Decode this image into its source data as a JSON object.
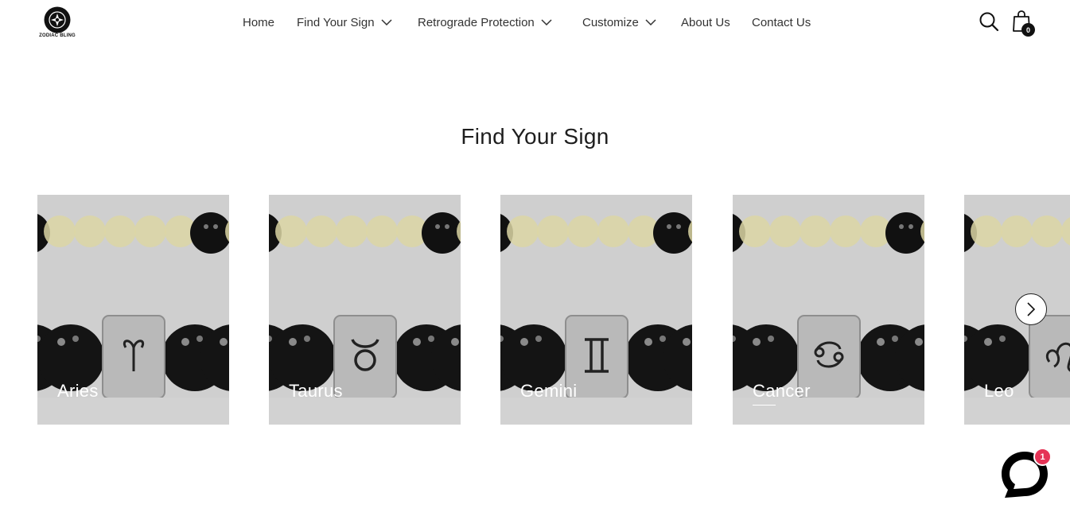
{
  "brand": {
    "name": "ZODIAC BLING"
  },
  "nav": {
    "items": [
      {
        "label": "Home",
        "has_dropdown": false
      },
      {
        "label": "Find Your Sign",
        "has_dropdown": true
      },
      {
        "label": "Retrograde Protection",
        "has_dropdown": true
      },
      {
        "label": "Customize",
        "has_dropdown": true
      },
      {
        "label": "About Us",
        "has_dropdown": false
      },
      {
        "label": "Contact Us",
        "has_dropdown": false
      }
    ]
  },
  "header_actions": {
    "search_icon": "search-icon",
    "cart_icon": "shopping-bag-icon",
    "cart_count": "0"
  },
  "section": {
    "title": "Find Your Sign",
    "cards": [
      {
        "label": "Aries",
        "symbol": "aries"
      },
      {
        "label": "Taurus",
        "symbol": "taurus"
      },
      {
        "label": "Gemini",
        "symbol": "gemini"
      },
      {
        "label": "Cancer",
        "symbol": "cancer",
        "active": true
      },
      {
        "label": "Leo",
        "symbol": "leo"
      }
    ],
    "next_icon": "chevron-right-icon"
  },
  "chat": {
    "icon": "chat-bubble-icon",
    "badge": "1"
  },
  "colors": {
    "accent_badge": "#e53356",
    "text": "#333333",
    "card_bg": "#cfcfcf"
  }
}
